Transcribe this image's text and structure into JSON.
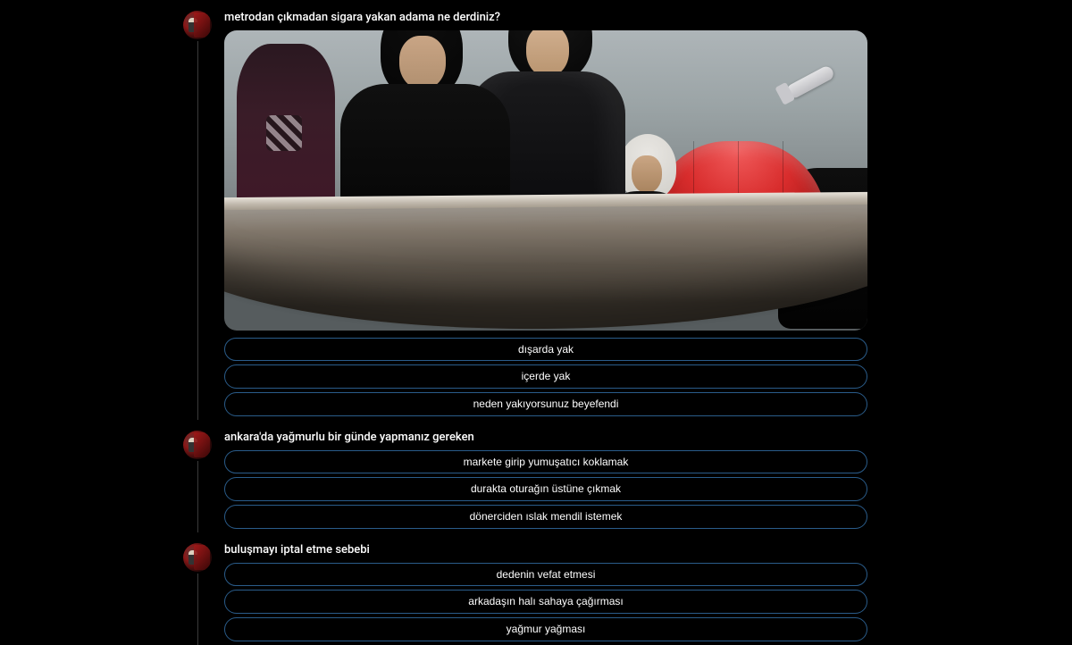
{
  "posts": [
    {
      "title": "metrodan çıkmadan sigara yakan adama ne derdiniz?",
      "options": [
        "dışarda yak",
        "içerde yak",
        "neden yakıyorsunuz beyefendi"
      ]
    },
    {
      "title": "ankara'da yağmurlu bir günde yapmanız gereken",
      "options": [
        "markete girip yumuşatıcı koklamak",
        "durakta oturağın üstüne çıkmak",
        "dönerciden ıslak mendil istemek"
      ]
    },
    {
      "title": "buluşmayı iptal etme sebebi",
      "options": [
        "dedenin vefat etmesi",
        "arkadaşın halı sahaya çağırması",
        "yağmur yağması"
      ]
    }
  ],
  "colors": {
    "pill_border": "#2a5c8a"
  }
}
